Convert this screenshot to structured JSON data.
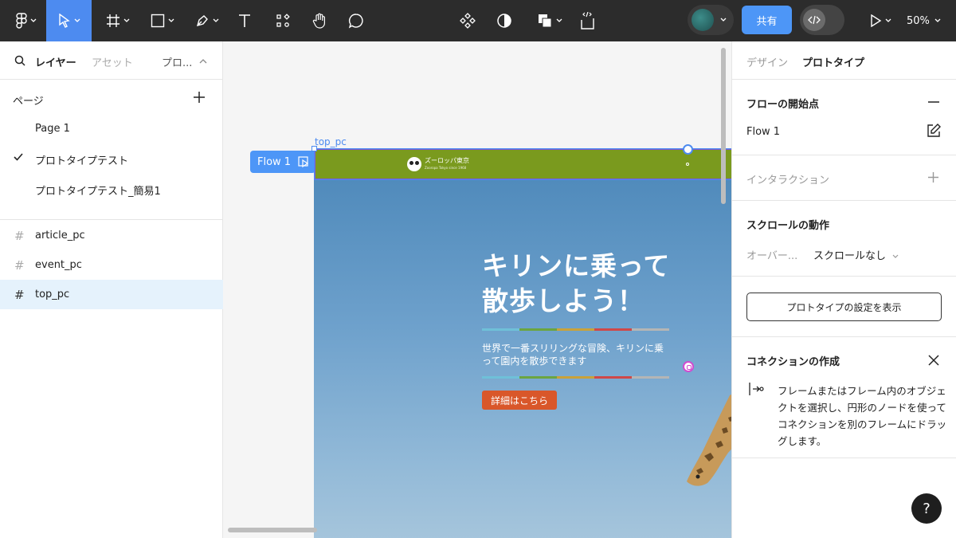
{
  "toolbar": {
    "share_label": "共有",
    "zoom_label": "50%"
  },
  "left_panel": {
    "tabs": [
      "レイヤー",
      "アセット",
      "プロ..."
    ],
    "pages_header": "ページ",
    "pages": [
      "Page 1",
      "プロトタイプテスト",
      "プロトタイプテスト_簡易1"
    ],
    "layers": [
      "article_pc",
      "event_pc",
      "top_pc"
    ]
  },
  "canvas": {
    "frame_label": "top_pc",
    "flow_chip": "Flow 1",
    "logo_title": "ズーロッパ東京",
    "logo_subtitle": "Zooropa Tokyo since 1968",
    "hero_title_line1": "キリンに乗って",
    "hero_title_line2": "散歩しよう！",
    "hero_desc": "世界で一番スリリングな冒険、キリンに乗って園内を散歩できます",
    "cta_label": "詳細はこちら"
  },
  "right_panel": {
    "tabs": [
      "デザイン",
      "プロトタイプ"
    ],
    "flow_start_title": "フローの開始点",
    "flow_name": "Flow 1",
    "interaction_title": "インタラクション",
    "scroll_title": "スクロールの動作",
    "overflow_label": "オーバー...",
    "overflow_value": "スクロールなし",
    "proto_settings_button": "プロトタイプの設定を表示",
    "connection_title": "コネクションの作成",
    "connection_desc": "フレームまたはフレーム内のオブジェクトを選択し、円形のノードを使ってコネクションを別のフレームにドラッグします。",
    "help_label": "?"
  },
  "colors": {
    "toolbar_bg": "#2c2c2c",
    "accent": "#4d96f7",
    "header_green": "#7a9a1e",
    "cta_orange": "#d9572a",
    "selected_layer": "#e5f2fc"
  }
}
